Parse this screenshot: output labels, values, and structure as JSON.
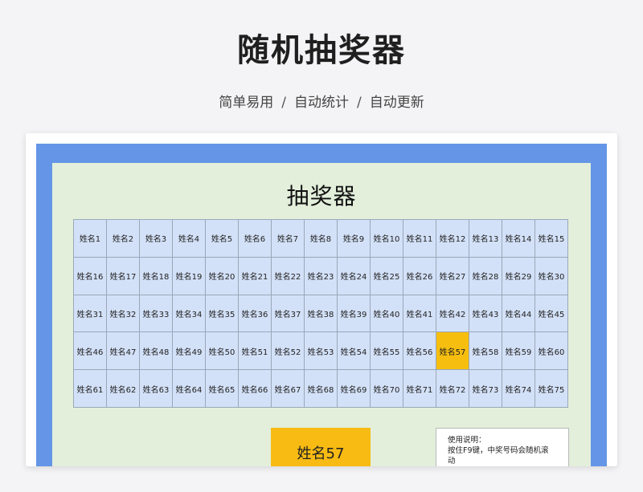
{
  "hero": {
    "title": "随机抽奖器",
    "features": [
      "简单易用",
      "自动统计",
      "自动更新"
    ],
    "separator": "/"
  },
  "sheet": {
    "title": "抽奖器",
    "names": [
      "姓名1",
      "姓名2",
      "姓名3",
      "姓名4",
      "姓名5",
      "姓名6",
      "姓名7",
      "姓名8",
      "姓名9",
      "姓名10",
      "姓名11",
      "姓名12",
      "姓名13",
      "姓名14",
      "姓名15",
      "姓名16",
      "姓名17",
      "姓名18",
      "姓名19",
      "姓名20",
      "姓名21",
      "姓名22",
      "姓名23",
      "姓名24",
      "姓名25",
      "姓名26",
      "姓名27",
      "姓名28",
      "姓名29",
      "姓名30",
      "姓名31",
      "姓名32",
      "姓名33",
      "姓名34",
      "姓名35",
      "姓名36",
      "姓名37",
      "姓名38",
      "姓名39",
      "姓名40",
      "姓名41",
      "姓名42",
      "姓名43",
      "姓名44",
      "姓名45",
      "姓名46",
      "姓名47",
      "姓名48",
      "姓名49",
      "姓名50",
      "姓名51",
      "姓名52",
      "姓名53",
      "姓名54",
      "姓名55",
      "姓名56",
      "姓名57",
      "姓名58",
      "姓名59",
      "姓名60",
      "姓名61",
      "姓名62",
      "姓名63",
      "姓名64",
      "姓名65",
      "姓名66",
      "姓名67",
      "姓名68",
      "姓名69",
      "姓名70",
      "姓名71",
      "姓名72",
      "姓名73",
      "姓名74",
      "姓名75"
    ],
    "highlighted_name": "姓名57",
    "winner": "姓名57",
    "instructions": {
      "heading": "使用说明：",
      "line1": "按住F9键，中奖号码会随机滚",
      "line2": "动"
    }
  },
  "colors": {
    "frame": "#6495e6",
    "sheet_bg": "#e3efdb",
    "cell_bg": "#d3e1f8",
    "highlight": "#f6be0f"
  }
}
